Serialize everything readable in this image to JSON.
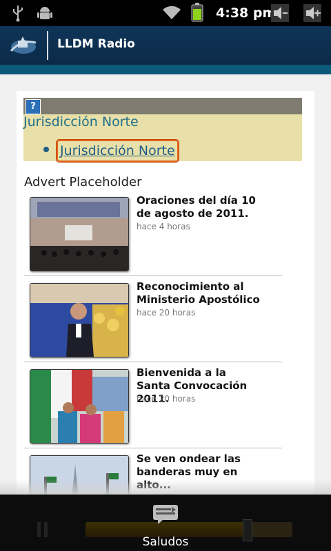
{
  "status_bar": {
    "time": "4:38 pm",
    "icons": [
      "usb-icon",
      "android-debug-icon",
      "wifi-icon",
      "battery-icon",
      "volume-down-icon",
      "volume-up-icon"
    ]
  },
  "app_bar": {
    "title": "LLDM Radio",
    "logo_icon": "lldm-logo-icon"
  },
  "module": {
    "help_icon": "?",
    "heading": "Jurisdicción Norte",
    "link_label": "Jurisdicción Norte"
  },
  "advert": "Advert Placeholder",
  "news": [
    {
      "title": "Oraciones del día 10 de agosto de 2011.",
      "time": "hace 4 horas",
      "thumb": "ceremony-photo"
    },
    {
      "title": "Reconocimiento al Ministerio Apostólico",
      "time": "hace 20 horas",
      "thumb": "speaker-photo"
    },
    {
      "title": "Bienvenida a la Santa Convocación 2011.",
      "time": "hace 20 horas",
      "thumb": "flags-crowd-photo"
    },
    {
      "title": "Se ven ondear las banderas muy en alto...",
      "time": "",
      "thumb": "temple-photo"
    }
  ],
  "player": {
    "label": "Saludos",
    "progress": 0.78,
    "colors": {
      "accent": "#e2651e",
      "link": "#1f5f86",
      "header": "#0f3558"
    }
  }
}
